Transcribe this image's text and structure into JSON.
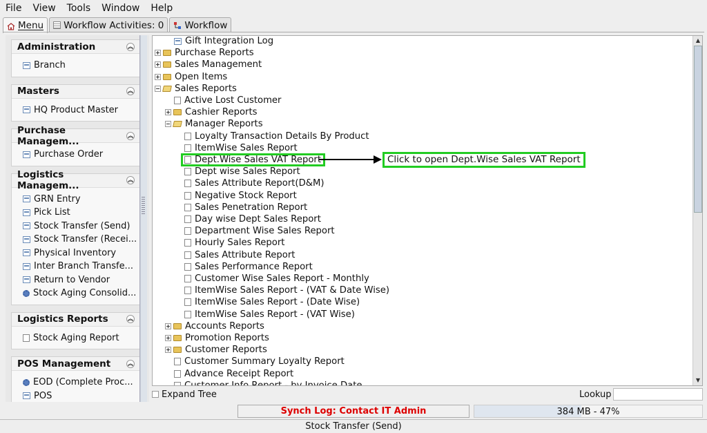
{
  "menubar": [
    "File",
    "View",
    "Tools",
    "Window",
    "Help"
  ],
  "tabs": [
    {
      "label": "Menu",
      "icon": "home-icon"
    },
    {
      "label": "Workflow Activities: 0",
      "icon": "list-icon"
    },
    {
      "label": "Workflow",
      "icon": "workflow-icon"
    }
  ],
  "sidebar": [
    {
      "title": "Administration",
      "items": [
        {
          "label": "Branch",
          "icon": "doc"
        }
      ]
    },
    {
      "title": "Masters",
      "items": [
        {
          "label": "HQ Product Master",
          "icon": "doc"
        }
      ]
    },
    {
      "title": "Purchase Managem...",
      "items": [
        {
          "label": "Purchase Order",
          "icon": "doc"
        }
      ]
    },
    {
      "title": "Logistics Managem...",
      "items": [
        {
          "label": "GRN Entry",
          "icon": "doc"
        },
        {
          "label": "Pick List",
          "icon": "doc"
        },
        {
          "label": "Stock Transfer (Send)",
          "icon": "doc"
        },
        {
          "label": "Stock Transfer (Recei...",
          "icon": "doc"
        },
        {
          "label": "Physical Inventory",
          "icon": "doc"
        },
        {
          "label": "Inter Branch Transfe...",
          "icon": "doc"
        },
        {
          "label": "Return to Vendor",
          "icon": "doc"
        },
        {
          "label": "Stock Aging Consolid...",
          "icon": "gear"
        }
      ]
    },
    {
      "title": "Logistics Reports",
      "items": [
        {
          "label": "Stock Aging Report",
          "icon": "page"
        }
      ]
    },
    {
      "title": "POS Management",
      "items": [
        {
          "label": "EOD (Complete Proc...",
          "icon": "gear"
        },
        {
          "label": "POS",
          "icon": "doc"
        }
      ]
    }
  ],
  "tree": [
    {
      "label": "Gift Integration Log",
      "level": 1,
      "type": "doc"
    },
    {
      "label": "Purchase Reports",
      "level": 0,
      "type": "folder",
      "exp": "plus"
    },
    {
      "label": "Sales Management",
      "level": 0,
      "type": "folder",
      "exp": "plus"
    },
    {
      "label": "Open Items",
      "level": 0,
      "type": "folder",
      "exp": "plus"
    },
    {
      "label": "Sales Reports",
      "level": 0,
      "type": "folderopen",
      "exp": "minus"
    },
    {
      "label": "Active Lost Customer",
      "level": 1,
      "type": "page"
    },
    {
      "label": "Cashier Reports",
      "level": 1,
      "type": "folder",
      "exp": "plus"
    },
    {
      "label": "Manager Reports",
      "level": 1,
      "type": "folderopen",
      "exp": "minus"
    },
    {
      "label": "Loyalty Transaction Details By Product",
      "level": 2,
      "type": "page"
    },
    {
      "label": "ItemWise Sales Report",
      "level": 2,
      "type": "page"
    },
    {
      "label": "Dept.Wise Sales VAT Report",
      "level": 2,
      "type": "page",
      "highlight": true
    },
    {
      "label": "Dept wise Sales Report",
      "level": 2,
      "type": "page"
    },
    {
      "label": "Sales Attribute Report(D&M)",
      "level": 2,
      "type": "page"
    },
    {
      "label": "Negative Stock Report",
      "level": 2,
      "type": "page"
    },
    {
      "label": "Sales Penetration Report",
      "level": 2,
      "type": "page"
    },
    {
      "label": "Day wise Dept Sales Report",
      "level": 2,
      "type": "page"
    },
    {
      "label": "Department Wise Sales Report",
      "level": 2,
      "type": "page"
    },
    {
      "label": "Hourly Sales Report",
      "level": 2,
      "type": "page"
    },
    {
      "label": "Sales Attribute Report",
      "level": 2,
      "type": "page"
    },
    {
      "label": "Sales Performance Report",
      "level": 2,
      "type": "page"
    },
    {
      "label": "Customer Wise Sales Report - Monthly",
      "level": 2,
      "type": "page"
    },
    {
      "label": "ItemWise Sales Report - (VAT & Date Wise)",
      "level": 2,
      "type": "page"
    },
    {
      "label": "ItemWise Sales Report - (Date Wise)",
      "level": 2,
      "type": "page"
    },
    {
      "label": "ItemWise Sales Report - (VAT Wise)",
      "level": 2,
      "type": "page"
    },
    {
      "label": "Accounts Reports",
      "level": 1,
      "type": "folder",
      "exp": "plus"
    },
    {
      "label": "Promotion Reports",
      "level": 1,
      "type": "folder",
      "exp": "plus"
    },
    {
      "label": "Customer Reports",
      "level": 1,
      "type": "folder",
      "exp": "plus"
    },
    {
      "label": "Customer Summary Loyalty Report",
      "level": 1,
      "type": "page"
    },
    {
      "label": "Advance Receipt Report",
      "level": 1,
      "type": "page"
    },
    {
      "label": "Customer Info Report - by Invoice Date",
      "level": 1,
      "type": "page"
    }
  ],
  "callout": "Click to open Dept.Wise Sales VAT Report",
  "expand_tree": "Expand Tree",
  "lookup": "Lookup",
  "synch_log": "Synch Log: Contact IT Admin",
  "memory": {
    "text": "384 MB - 47%",
    "percent": 47
  },
  "status": "Stock Transfer (Send)"
}
